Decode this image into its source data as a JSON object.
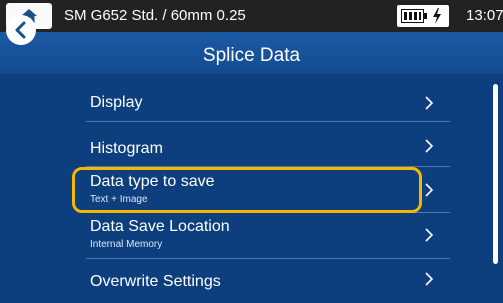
{
  "status": {
    "device_title": "SM G652 Std. / 60mm 0.25",
    "time": "13:07"
  },
  "header": {
    "title": "Splice Data"
  },
  "menu": {
    "items": [
      {
        "label": "Display",
        "sublabel": ""
      },
      {
        "label": "Histogram",
        "sublabel": ""
      },
      {
        "label": "Data type to save",
        "sublabel": "Text + Image"
      },
      {
        "label": "Data Save Location",
        "sublabel": "Internal Memory"
      },
      {
        "label": "Overwrite Settings",
        "sublabel": ""
      }
    ]
  },
  "icons": {
    "home": "home-icon",
    "battery": "battery-icon",
    "power": "plug-icon",
    "back": "back-arrow-icon",
    "chevron": "chevron-right-icon"
  },
  "colors": {
    "background": "#0d3f7e",
    "highlight": "#f5b700",
    "statusbar": "#222222"
  }
}
